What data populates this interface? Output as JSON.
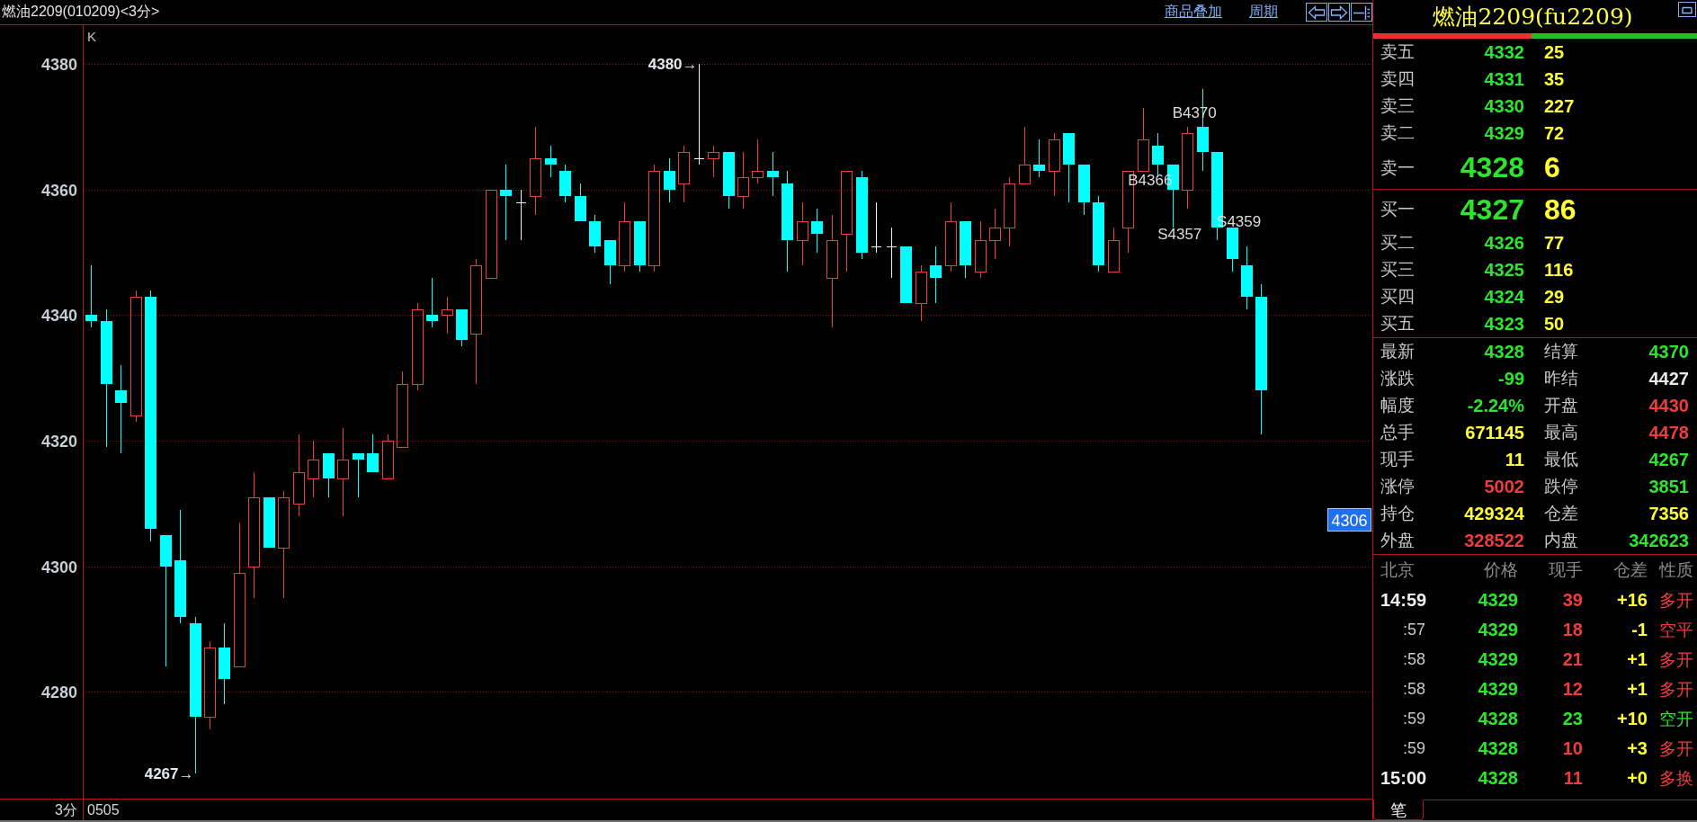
{
  "header": {
    "title": "燃油2209(010209)<3分>",
    "links": [
      "商品叠加",
      "周期"
    ]
  },
  "chart": {
    "high_marker": "4380→",
    "low_marker": "4267→",
    "price_tag": "4306",
    "chart_data": {
      "type": "candlestick",
      "title": "K",
      "ylim": [
        4263,
        4386.2
      ],
      "yticks": [
        4280,
        4300,
        4320,
        4340,
        4360,
        4380
      ],
      "grid": true,
      "categories": [
        null,
        null,
        null,
        null,
        null,
        null,
        null,
        null,
        null,
        null,
        null,
        null,
        null,
        null,
        null,
        null,
        null,
        null,
        null,
        null,
        null,
        null,
        null,
        null,
        null,
        null,
        null,
        null,
        null,
        null,
        null,
        null,
        null,
        null,
        null,
        null,
        null,
        null,
        null,
        null,
        null,
        null,
        null,
        null,
        null,
        null,
        null,
        null,
        null,
        null,
        null,
        null,
        null,
        null,
        null,
        null,
        null,
        null,
        null,
        null,
        null,
        null,
        null,
        null,
        null,
        null,
        null,
        null,
        null,
        null,
        null,
        null,
        null,
        null,
        null,
        null,
        null,
        null,
        null,
        null,
        null,
        null,
        null,
        null,
        null,
        null,
        null
      ],
      "ohlc": [
        [
          4340,
          4348,
          4338,
          4339
        ],
        [
          4339,
          4341,
          4319,
          4329
        ],
        [
          4328,
          4332,
          4318,
          4326
        ],
        [
          4324,
          4344,
          4323,
          4343
        ],
        [
          4343,
          4344,
          4304,
          4306
        ],
        [
          4305,
          4305,
          4284,
          4300
        ],
        [
          4301,
          4309,
          4291,
          4292
        ],
        [
          4291,
          4292,
          4267,
          4276
        ],
        [
          4276,
          4288,
          4274,
          4287
        ],
        [
          4287,
          4291,
          4278,
          4282
        ],
        [
          4284,
          4307,
          4284,
          4299
        ],
        [
          4300,
          4315,
          4295,
          4311
        ],
        [
          4311,
          4311,
          4303,
          4303
        ],
        [
          4303,
          4312,
          4295,
          4311
        ],
        [
          4310,
          4321,
          4308,
          4315
        ],
        [
          4314,
          4320,
          4311,
          4317
        ],
        [
          4318,
          4318,
          4311,
          4314
        ],
        [
          4314,
          4322,
          4308,
          4317
        ],
        [
          4318,
          4318,
          4311,
          4317
        ],
        [
          4318,
          4321,
          4315,
          4315
        ],
        [
          4314,
          4321,
          4314,
          4320
        ],
        [
          4319,
          4331,
          4319,
          4329
        ],
        [
          4329,
          4342,
          4328,
          4341
        ],
        [
          4340,
          4346,
          4338,
          4339
        ],
        [
          4340,
          4343,
          4337,
          4341
        ],
        [
          4341,
          4341,
          4335,
          4336
        ],
        [
          4337,
          4349,
          4329,
          4348
        ],
        [
          4346,
          4360,
          4346,
          4360
        ],
        [
          4360,
          4364,
          4352,
          4359
        ],
        [
          4358,
          4360,
          4352,
          4358
        ],
        [
          4359,
          4370,
          4356,
          4365
        ],
        [
          4365,
          4367,
          4362,
          4364
        ],
        [
          4363,
          4364,
          4358,
          4359
        ],
        [
          4359,
          4361,
          4355,
          4355
        ],
        [
          4355,
          4356,
          4350,
          4351
        ],
        [
          4352,
          4352,
          4345,
          4348
        ],
        [
          4348,
          4358,
          4347,
          4355
        ],
        [
          4355,
          4355,
          4347,
          4348
        ],
        [
          4348,
          4364,
          4347,
          4363
        ],
        [
          4363,
          4365,
          4358,
          4360
        ],
        [
          4361,
          4367,
          4358,
          4366
        ],
        [
          4365,
          4380,
          4364,
          4365
        ],
        [
          4365,
          4367,
          4362,
          4366
        ],
        [
          4366,
          4366,
          4357,
          4359
        ],
        [
          4359,
          4366,
          4357,
          4362
        ],
        [
          4362,
          4368,
          4361,
          4363
        ],
        [
          4363,
          4366,
          4359,
          4362
        ],
        [
          4361,
          4363,
          4347,
          4352
        ],
        [
          4352,
          4358,
          4348,
          4355
        ],
        [
          4355,
          4357,
          4350,
          4353
        ],
        [
          4346,
          4356,
          4338,
          4352
        ],
        [
          4353,
          4363,
          4347,
          4363
        ],
        [
          4362,
          4363,
          4349,
          4350
        ],
        [
          4351,
          4358,
          4350,
          4351
        ],
        [
          4351,
          4354,
          4346,
          4351
        ],
        [
          4351,
          4351,
          4342,
          4342
        ],
        [
          4342,
          4348,
          4339,
          4347
        ],
        [
          4348,
          4351,
          4342,
          4346
        ],
        [
          4348,
          4358,
          4347,
          4355
        ],
        [
          4355,
          4355,
          4346,
          4348
        ],
        [
          4347,
          4355,
          4346,
          4352
        ],
        [
          4352,
          4357,
          4349,
          4354
        ],
        [
          4354,
          4362,
          4351,
          4361
        ],
        [
          4361,
          4370,
          4361,
          4364
        ],
        [
          4364,
          4368,
          4362,
          4363
        ],
        [
          4363,
          4369,
          4359,
          4368
        ],
        [
          4369,
          4369,
          4358,
          4364
        ],
        [
          4364,
          4364,
          4356,
          4358
        ],
        [
          4358,
          4359,
          4347,
          4348
        ],
        [
          4347,
          4354,
          4347,
          4352
        ],
        [
          4354,
          4363,
          4350,
          4363
        ],
        [
          4363,
          4373,
          4363,
          4368
        ],
        [
          4367,
          4369,
          4362,
          4364
        ],
        [
          4364,
          4364,
          4354,
          4360
        ],
        [
          4360,
          4370,
          4357,
          4369
        ],
        [
          4370,
          4376,
          4363,
          4366
        ],
        [
          4366,
          4366,
          4352,
          4354
        ],
        [
          4354,
          4354,
          4347,
          4349
        ],
        [
          4348,
          4351,
          4341,
          4343
        ],
        [
          4343,
          4345,
          4321,
          4328
        ],
        null,
        null,
        null,
        null,
        null,
        null,
        null
      ],
      "annotations": [
        "B4366",
        "B4370",
        "S4357",
        "S4359"
      ]
    }
  },
  "bottom_bar": {
    "period": "3分",
    "date": "0505"
  },
  "quote_panel": {
    "title": "燃油2209(fu2209)",
    "strength_bar": {
      "level": 0.49
    },
    "asks": [
      {
        "label": "卖五",
        "price": "4332",
        "volume": "25",
        "kind": "depth"
      },
      {
        "label": "卖四",
        "price": "4331",
        "volume": "35",
        "kind": "depth"
      },
      {
        "label": "卖三",
        "price": "4330",
        "volume": "227",
        "kind": "depth"
      },
      {
        "label": "卖二",
        "price": "4329",
        "volume": "72",
        "kind": "depth"
      },
      {
        "label": "卖一",
        "price": "4328",
        "volume": "6",
        "kind": "best"
      }
    ],
    "bids": [
      {
        "label": "买一",
        "price": "4327",
        "volume": "86",
        "kind": "best"
      },
      {
        "label": "买二",
        "price": "4326",
        "volume": "77",
        "kind": "depth"
      },
      {
        "label": "买三",
        "price": "4325",
        "volume": "116",
        "kind": "depth"
      },
      {
        "label": "买四",
        "price": "4324",
        "volume": "29",
        "kind": "depth"
      },
      {
        "label": "买五",
        "price": "4323",
        "volume": "50",
        "kind": "depth"
      }
    ],
    "stats": [
      {
        "label": "最新",
        "value": "4328",
        "color": "#2ee52e"
      },
      {
        "label": "结算",
        "value": "4370",
        "color": "#2ee52e"
      },
      {
        "label": "涨跌",
        "value": "-99",
        "color": "#2ee52e"
      },
      {
        "label": "昨结",
        "value": "4427",
        "color": "#e8e8e8"
      },
      {
        "label": "幅度",
        "value": "-2.24%",
        "color": "#2ee52e"
      },
      {
        "label": "开盘",
        "value": "4430",
        "color": "#f03c3c"
      },
      {
        "label": "总手",
        "value": "671145",
        "color": "#ffff33"
      },
      {
        "label": "最高",
        "value": "4478",
        "color": "#f03c3c"
      },
      {
        "label": "现手",
        "value": "11",
        "color": "#ffff33"
      },
      {
        "label": "最低",
        "value": "4267",
        "color": "#2ee52e"
      },
      {
        "label": "涨停",
        "value": "5002",
        "color": "#f03c3c"
      },
      {
        "label": "跌停",
        "value": "3851",
        "color": "#2ee52e"
      },
      {
        "label": "持仓",
        "value": "429324",
        "color": "#ffff33"
      },
      {
        "label": "仓差",
        "value": "7356",
        "color": "#ffff33"
      },
      {
        "label": "外盘",
        "value": "328522",
        "color": "#f03c3c"
      },
      {
        "label": "内盘",
        "value": "342623",
        "color": "#2ee52e"
      }
    ],
    "trades": {
      "columns": [
        "北京",
        "价格",
        "现手",
        "仓差",
        "性质"
      ],
      "rows": [
        {
          "time": "14:59",
          "kind": "full",
          "price": "4329",
          "volume": "39",
          "oi_change": "+16",
          "nature": "多开",
          "color": "#f03c3c"
        },
        {
          "time": ":57",
          "kind": "short",
          "price": "4329",
          "volume": "18",
          "oi_change": "-1",
          "nature": "空平",
          "color": "#f03c3c"
        },
        {
          "time": ":58",
          "kind": "short",
          "price": "4329",
          "volume": "21",
          "oi_change": "+1",
          "nature": "多开",
          "color": "#f03c3c"
        },
        {
          "time": ":58",
          "kind": "short",
          "price": "4329",
          "volume": "12",
          "oi_change": "+1",
          "nature": "多开",
          "color": "#f03c3c"
        },
        {
          "time": ":59",
          "kind": "short",
          "price": "4328",
          "volume": "23",
          "oi_change": "+10",
          "nature": "空开",
          "color": "#2ee52e"
        },
        {
          "time": ":59",
          "kind": "short",
          "price": "4328",
          "volume": "10",
          "oi_change": "+3",
          "nature": "多开",
          "color": "#f03c3c"
        },
        {
          "time": "15:00",
          "kind": "full",
          "price": "4328",
          "volume": "11",
          "oi_change": "+0",
          "nature": "多换",
          "color": "#f03c3c"
        }
      ]
    },
    "tabs": [
      {
        "label": "笔",
        "selected": true
      }
    ]
  }
}
